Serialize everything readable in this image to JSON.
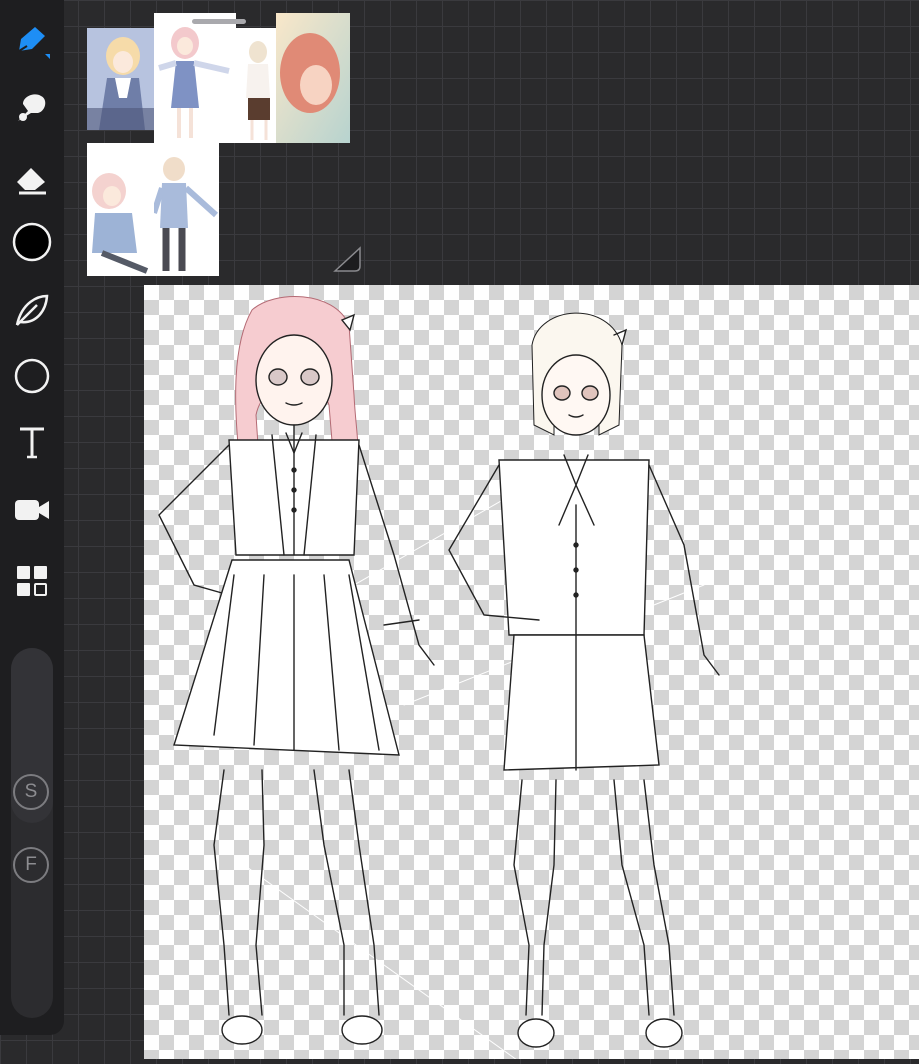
{
  "app": {
    "accent_color": "#1e8ef5",
    "canvas_bg": "#2a2a2c"
  },
  "toolbar": {
    "tools": [
      {
        "name": "pen-tool",
        "icon": "pen-icon",
        "active": true
      },
      {
        "name": "smudge-tool",
        "icon": "smudge-icon",
        "active": false
      },
      {
        "name": "eraser-tool",
        "icon": "eraser-icon",
        "active": false
      },
      {
        "name": "color-picker",
        "icon": "color-swatch-icon",
        "color": "#000000"
      },
      {
        "name": "lasso-tool",
        "icon": "lasso-leaf-icon"
      },
      {
        "name": "shape-tool",
        "icon": "circle-icon"
      },
      {
        "name": "text-tool",
        "icon": "text-icon",
        "label": "T"
      },
      {
        "name": "video-tool",
        "icon": "video-camera-icon"
      },
      {
        "name": "layers-tool",
        "icon": "layers-grid-icon"
      }
    ],
    "size_button_label": "S",
    "flow_button_label": "F"
  },
  "reference_panel": {
    "thumbnails": [
      {
        "name": "ref-thumb-blue-dress",
        "bg": "#9aa7c9"
      },
      {
        "name": "ref-thumb-pink-hair-dress",
        "bg": "#eef0f6"
      },
      {
        "name": "ref-thumb-brown-shorts",
        "bg": "#ffffff"
      },
      {
        "name": "ref-thumb-red-hair-close",
        "bg": "#e7b098"
      },
      {
        "name": "ref-thumb-seated-pink",
        "bg": "#ffffff"
      },
      {
        "name": "ref-thumb-standing-sweater",
        "bg": "#ffffff"
      }
    ]
  },
  "canvas": {
    "figures": [
      {
        "name": "girl-figure-left",
        "hair_color": "#f3c3c7"
      },
      {
        "name": "girl-figure-right",
        "hair_color": "#f7f1e6"
      }
    ]
  }
}
